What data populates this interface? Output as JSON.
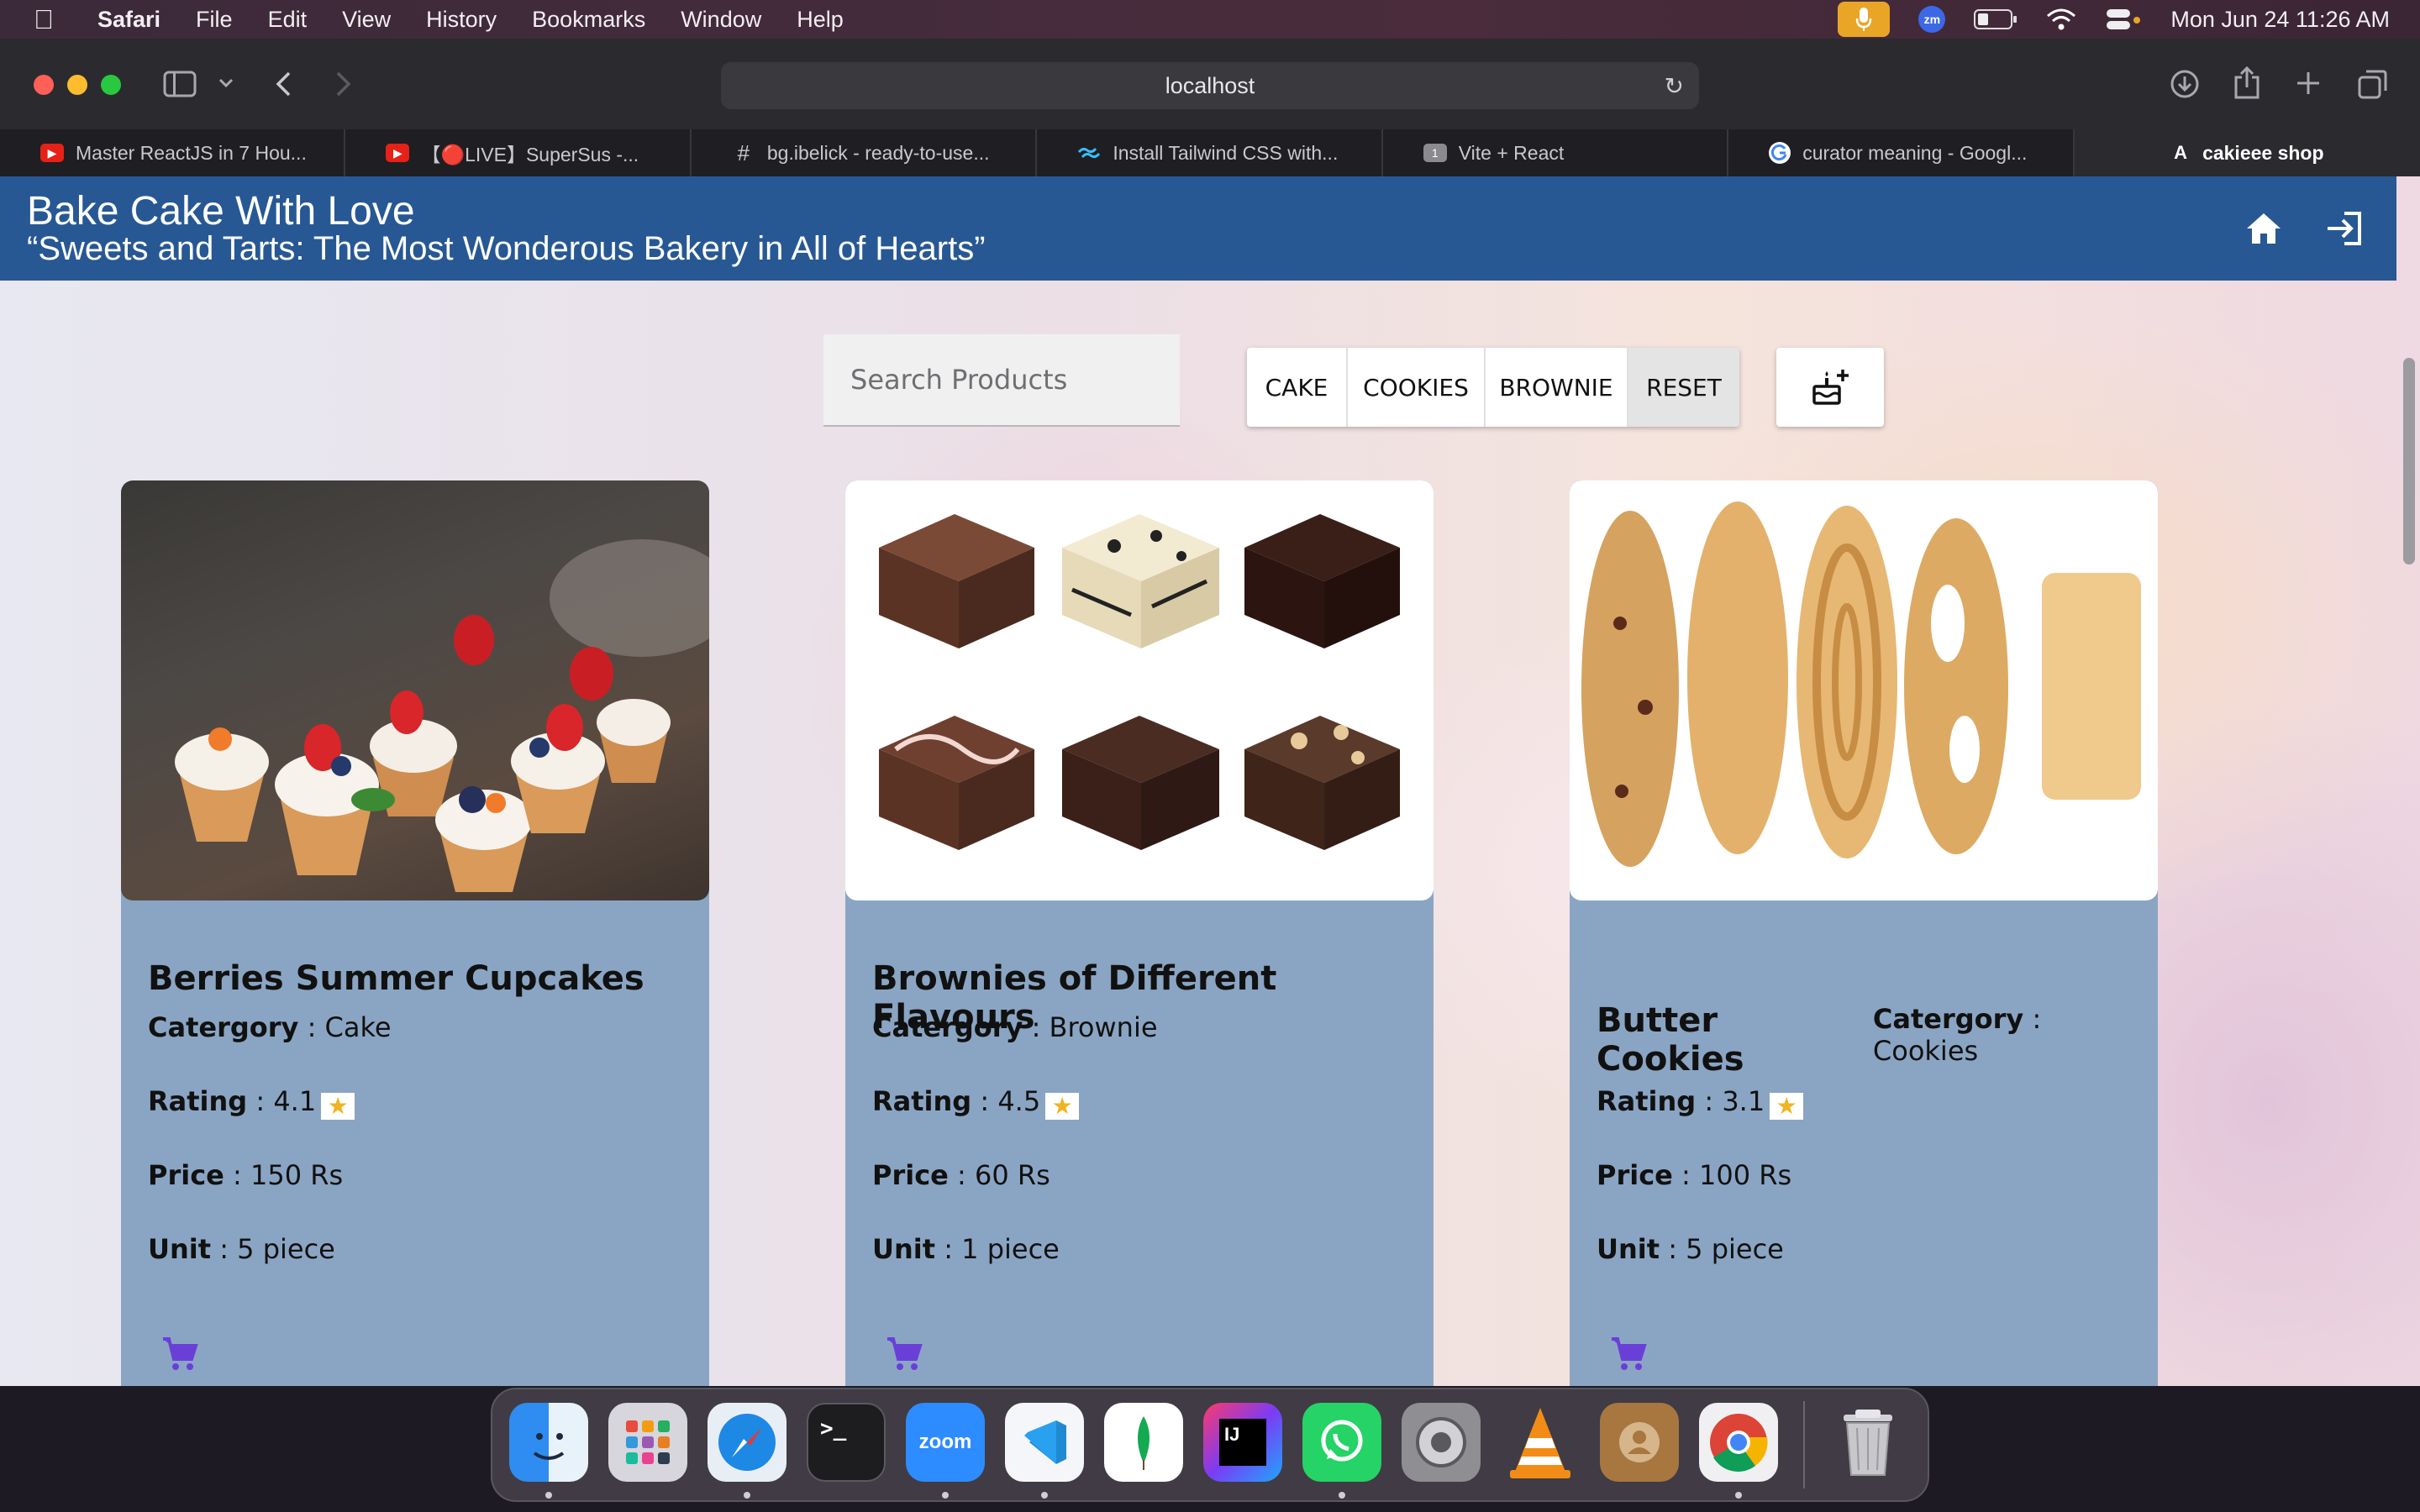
{
  "menubar": {
    "app": "Safari",
    "items": [
      "File",
      "Edit",
      "View",
      "History",
      "Bookmarks",
      "Window",
      "Help"
    ],
    "datetime": "Mon Jun 24  11:26 AM",
    "zoom_label": "zm"
  },
  "browser": {
    "url": "localhost",
    "tabs": [
      {
        "label": "Master ReactJS in 7 Hou...",
        "icon": "youtube-icon"
      },
      {
        "label": "【🔴LIVE】SuperSus -...",
        "icon": "youtube-icon"
      },
      {
        "label": "bg.ibelick - ready-to-use...",
        "icon": "hash-icon"
      },
      {
        "label": "Install Tailwind CSS with...",
        "icon": "tailwind-icon"
      },
      {
        "label": "Vite + React",
        "icon": "vite-icon",
        "badge": "1"
      },
      {
        "label": "curator meaning - Googl...",
        "icon": "google-icon"
      },
      {
        "label": "cakieee shop",
        "icon": "app-icon",
        "badge": "A"
      }
    ]
  },
  "site": {
    "title": "Bake Cake With Love",
    "tagline": "“Sweets and Tarts: The Most Wonderous Bakery in All of Hearts”",
    "search_placeholder": "Search Products",
    "filters": [
      "CAKE",
      "COOKIES",
      "BROWNIE",
      "RESET"
    ]
  },
  "products": [
    {
      "name": "Berries Summer Cupcakes",
      "category_label": "Catergory",
      "category": "Cake",
      "rating_label": "Rating",
      "rating": "4.1",
      "price_label": "Price",
      "price": "150 Rs",
      "unit_label": "Unit",
      "unit": "5 piece"
    },
    {
      "name": "Brownies of Different Flavours",
      "category_label": "Catergory",
      "category": "Brownie",
      "rating_label": "Rating",
      "rating": "4.5",
      "price_label": "Price",
      "price": "60 Rs",
      "unit_label": "Unit",
      "unit": "1 piece"
    },
    {
      "name": "Butter Cookies",
      "category_label": "Catergory",
      "category": "Cookies",
      "rating_label": "Rating",
      "rating": "3.1",
      "price_label": "Price",
      "price": "100 Rs",
      "unit_label": "Unit",
      "unit": "5 piece"
    }
  ],
  "separator": " : ",
  "star": "★",
  "dock": {
    "terminal_label": ">_",
    "zoom_label": "zoom",
    "intellij_label": "IJ"
  },
  "colors": {
    "navbar": "#275894",
    "card": "#8aa5c3",
    "cart_icon": "#6a3fd8",
    "star": "#f0b323"
  }
}
